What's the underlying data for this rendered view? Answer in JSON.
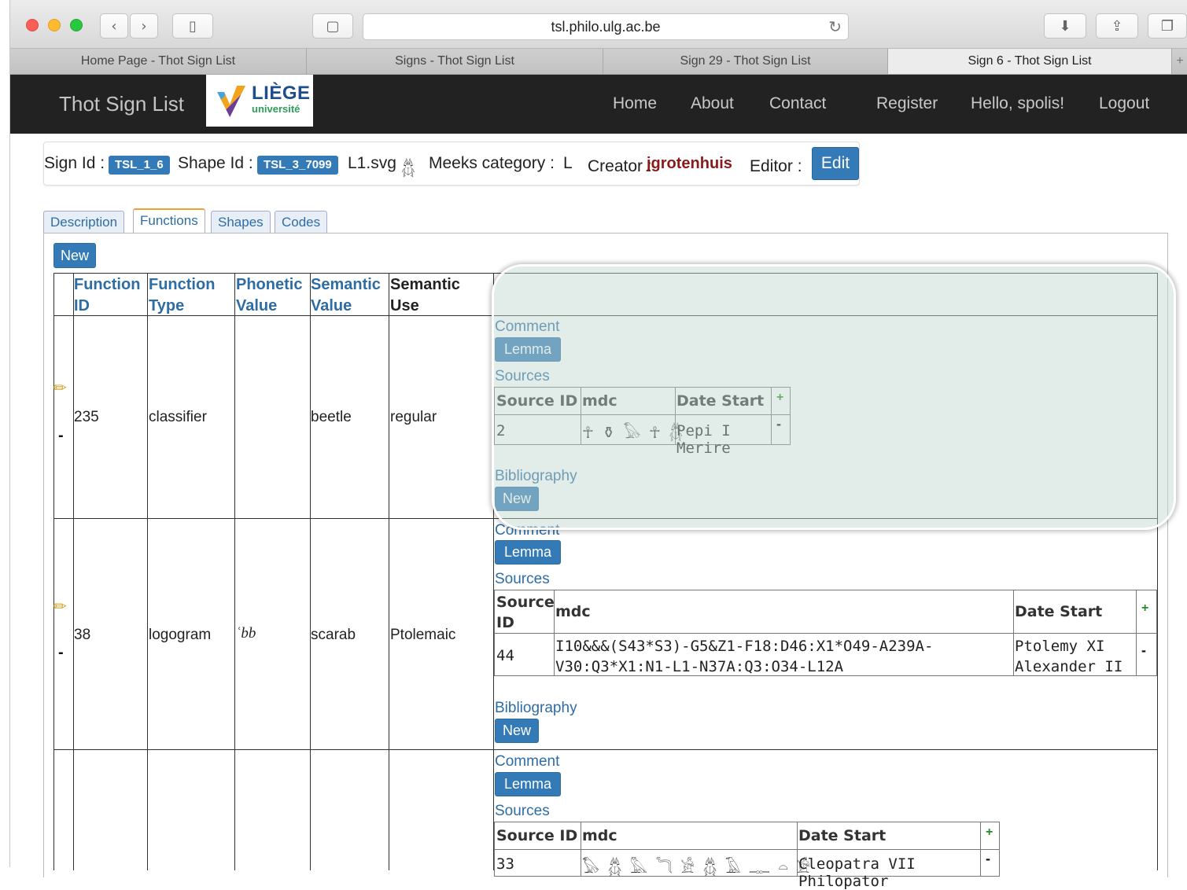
{
  "browser": {
    "url": "tsl.philo.ulg.ac.be",
    "tabs": [
      {
        "label": "Home Page - Thot Sign List",
        "active": false
      },
      {
        "label": "Signs - Thot Sign List",
        "active": false
      },
      {
        "label": "Sign 29 - Thot Sign List",
        "active": false
      },
      {
        "label": "Sign 6 - Thot Sign List",
        "active": true
      }
    ],
    "new_tab": "+"
  },
  "site": {
    "brand": "Thot Sign List",
    "logo_name": "LIÈGE",
    "logo_sub": "université",
    "nav": [
      "Home",
      "About",
      "Contact",
      "Register",
      "Hello, spolis!",
      "Logout"
    ]
  },
  "sign_info": {
    "sign_id_label": "Sign Id :",
    "sign_id": "TSL_1_6",
    "shape_id_label": "Shape Id :",
    "shape_id": "TSL_3_7099",
    "svg_file": "L1.svg",
    "meeks_label": "Meeks category :",
    "meeks_value": "L",
    "creator_label": "Creator :",
    "creator": "jgrotenhuis",
    "editor_label": "Editor :",
    "edit_button": "Edit"
  },
  "content_tabs": [
    "Description",
    "Functions",
    "Shapes",
    "Codes"
  ],
  "active_tab": "Functions",
  "new_button": "New",
  "functions_table": {
    "headers": {
      "function_id": [
        "Function",
        "ID"
      ],
      "function_type": [
        "Function",
        "Type"
      ],
      "phonetic_value": [
        "Phonetic",
        "Value"
      ],
      "semantic_value": [
        "Semantic",
        "Value"
      ],
      "semantic_use": [
        "Semantic",
        "Use"
      ]
    },
    "rows": [
      {
        "id": "235",
        "type": "classifier",
        "phonetic": "",
        "semantic": "beetle",
        "use": "regular",
        "comment": "Comment",
        "lemma": "Lemma",
        "sources": "Sources",
        "source_headers": [
          "Source ID",
          "mdc",
          "Date Start"
        ],
        "source_rows": [
          {
            "id": "2",
            "mdc": "☥ ⚱ 𓅃 ☥ 𓆣",
            "date": "Pepi I Merire"
          }
        ],
        "bibliography": "Bibliography",
        "bib_new": "New"
      },
      {
        "id": "38",
        "type": "logogram",
        "phonetic": "ʿbb",
        "semantic": "scarab",
        "use": "Ptolemaic",
        "comment": "Comment",
        "lemma": "Lemma",
        "sources": "Sources",
        "source_headers": [
          "Source",
          "ID",
          "mdc",
          "Date Start"
        ],
        "source_rows": [
          {
            "id": "44",
            "mdc_line1": "I10&&&(S43*S3)-G5&Z1-F18:D46:X1*O49-A239A-",
            "mdc_line2": "V30:Q3*X1:N1-L1-N37A:Q3:O34-L12A",
            "date_line1": "Ptolemy XI",
            "date_line2": "Alexander II"
          }
        ],
        "bibliography": "Bibliography",
        "bib_new": "New"
      },
      {
        "id": "",
        "type": "",
        "phonetic": "",
        "semantic": "",
        "use": "",
        "comment": "Comment",
        "lemma": "Lemma",
        "sources": "Sources",
        "source_headers": [
          "Source ID",
          "mdc",
          "Date Start"
        ],
        "source_rows": [
          {
            "id": "33",
            "mdc": "𓅃 𓆣 𓅓 𓆓 𓀀 𓆣 𓄿 𓊃 𓏏 𓀀",
            "date": "Cleopatra VII Philopator"
          }
        ]
      }
    ],
    "add_symbol": "+",
    "remove_symbol": "-"
  },
  "colors": {
    "accent": "#337ab7",
    "nav_bg": "#222222",
    "creator": "#8b1a1a",
    "highlight": "#bed4cd"
  }
}
